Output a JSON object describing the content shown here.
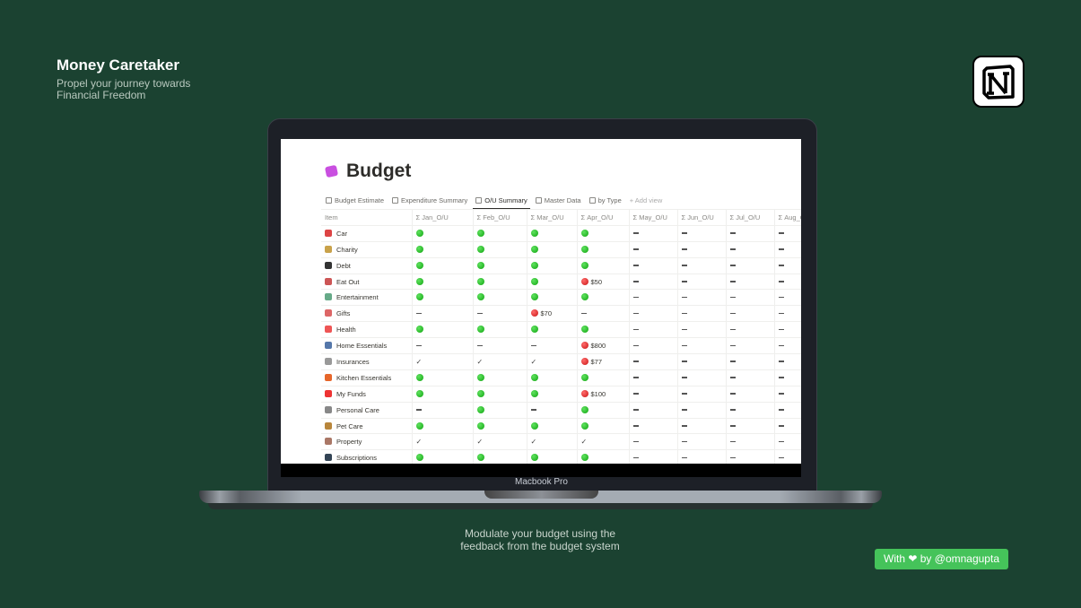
{
  "brand": {
    "title": "Money Caretaker",
    "subtitle_line1": "Propel your journey towards",
    "subtitle_line2": "Financial Freedom"
  },
  "logo": "notion-logo",
  "device": {
    "model": "Macbook Pro"
  },
  "page": {
    "title": "Budget",
    "icon": "wallet-icon",
    "tabs": [
      {
        "label": "Budget Estimate",
        "active": false
      },
      {
        "label": "Expenditure Summary",
        "active": false
      },
      {
        "label": "O/U Summary",
        "active": true
      },
      {
        "label": "Master Data",
        "active": false
      },
      {
        "label": "by Type",
        "active": false
      }
    ],
    "add_view": "+ Add view",
    "columns": [
      "Item",
      "Σ Jan_O/U",
      "Σ Feb_O/U",
      "Σ Mar_O/U",
      "Σ Apr_O/U",
      "Σ May_O/U",
      "Σ Jun_O/U",
      "Σ Jul_O/U",
      "Σ Aug_O/U"
    ],
    "rows": [
      {
        "item": "Car",
        "icon": "car-icon",
        "color": "#d44",
        "cells": [
          "green",
          "green",
          "green",
          "green",
          "-",
          "-",
          "-",
          "-"
        ]
      },
      {
        "item": "Charity",
        "icon": "charity-icon",
        "color": "#c9a24a",
        "cells": [
          "green",
          "green",
          "green",
          "green",
          "-",
          "-",
          "-",
          "-"
        ]
      },
      {
        "item": "Debt",
        "icon": "debt-icon",
        "color": "#333",
        "cells": [
          "green",
          "green",
          "green",
          "green",
          "-",
          "-",
          "-",
          "-"
        ]
      },
      {
        "item": "Eat Out",
        "icon": "eat-out-icon",
        "color": "#c55",
        "cells": [
          "green",
          "green",
          "green",
          {
            "status": "red",
            "amount": "$50"
          },
          "-",
          "-",
          "-",
          "-"
        ]
      },
      {
        "item": "Entertainment",
        "icon": "entertainment-icon",
        "color": "#6a8",
        "cells": [
          "green",
          "green",
          "green",
          "green",
          "-",
          "-",
          "-",
          "-"
        ]
      },
      {
        "item": "Gifts",
        "icon": "gift-icon",
        "color": "#d66",
        "cells": [
          "-",
          "-",
          {
            "status": "red",
            "amount": "$70"
          },
          "-",
          "-",
          "-",
          "-",
          "-"
        ]
      },
      {
        "item": "Health",
        "icon": "health-icon",
        "color": "#e55",
        "cells": [
          "green",
          "green",
          "green",
          "green",
          "-",
          "-",
          "-",
          "-"
        ]
      },
      {
        "item": "Home Essentials",
        "icon": "home-essentials-icon",
        "color": "#57a",
        "cells": [
          "-",
          "-",
          "-",
          {
            "status": "red",
            "amount": "$800"
          },
          "-",
          "-",
          "-",
          "-"
        ]
      },
      {
        "item": "Insurances",
        "icon": "shield-icon",
        "color": "#999",
        "cells": [
          "check",
          "check",
          "check",
          {
            "status": "red",
            "amount": "$77"
          },
          "-",
          "-",
          "-",
          "-"
        ]
      },
      {
        "item": "Kitchen Essentials",
        "icon": "carrot-icon",
        "color": "#e6662a",
        "cells": [
          "green",
          "green",
          "green",
          "green",
          "-",
          "-",
          "-",
          "-"
        ]
      },
      {
        "item": "My Funds",
        "icon": "heart-icon",
        "color": "#e33",
        "cells": [
          "green",
          "green",
          "green",
          {
            "status": "red",
            "amount": "$100"
          },
          "-",
          "-",
          "-",
          "-"
        ]
      },
      {
        "item": "Personal Care",
        "icon": "personal-care-icon",
        "color": "#888",
        "cells": [
          "-",
          "green",
          "-",
          "green",
          "-",
          "-",
          "-",
          "-"
        ]
      },
      {
        "item": "Pet Care",
        "icon": "pet-icon",
        "color": "#b8863b",
        "cells": [
          "green",
          "green",
          "green",
          "green",
          "-",
          "-",
          "-",
          "-"
        ]
      },
      {
        "item": "Property",
        "icon": "house-icon",
        "color": "#a76",
        "cells": [
          "check",
          "check",
          "check",
          "check",
          "-",
          "-",
          "-",
          "-"
        ]
      },
      {
        "item": "Subscriptions",
        "icon": "monitor-icon",
        "color": "#345",
        "cells": [
          "green",
          "green",
          "green",
          "green",
          "-",
          "-",
          "-",
          "-"
        ]
      }
    ]
  },
  "caption": {
    "line1": "Modulate your budget using the",
    "line2": "feedback from the budget system"
  },
  "credit": {
    "prefix": "With",
    "suffix": "by @omnagupta",
    "heart": "❤"
  },
  "colors": {
    "background": "#1b4231",
    "credit_bg": "#45c35a",
    "over": "#d62020",
    "under": "#22b022"
  }
}
